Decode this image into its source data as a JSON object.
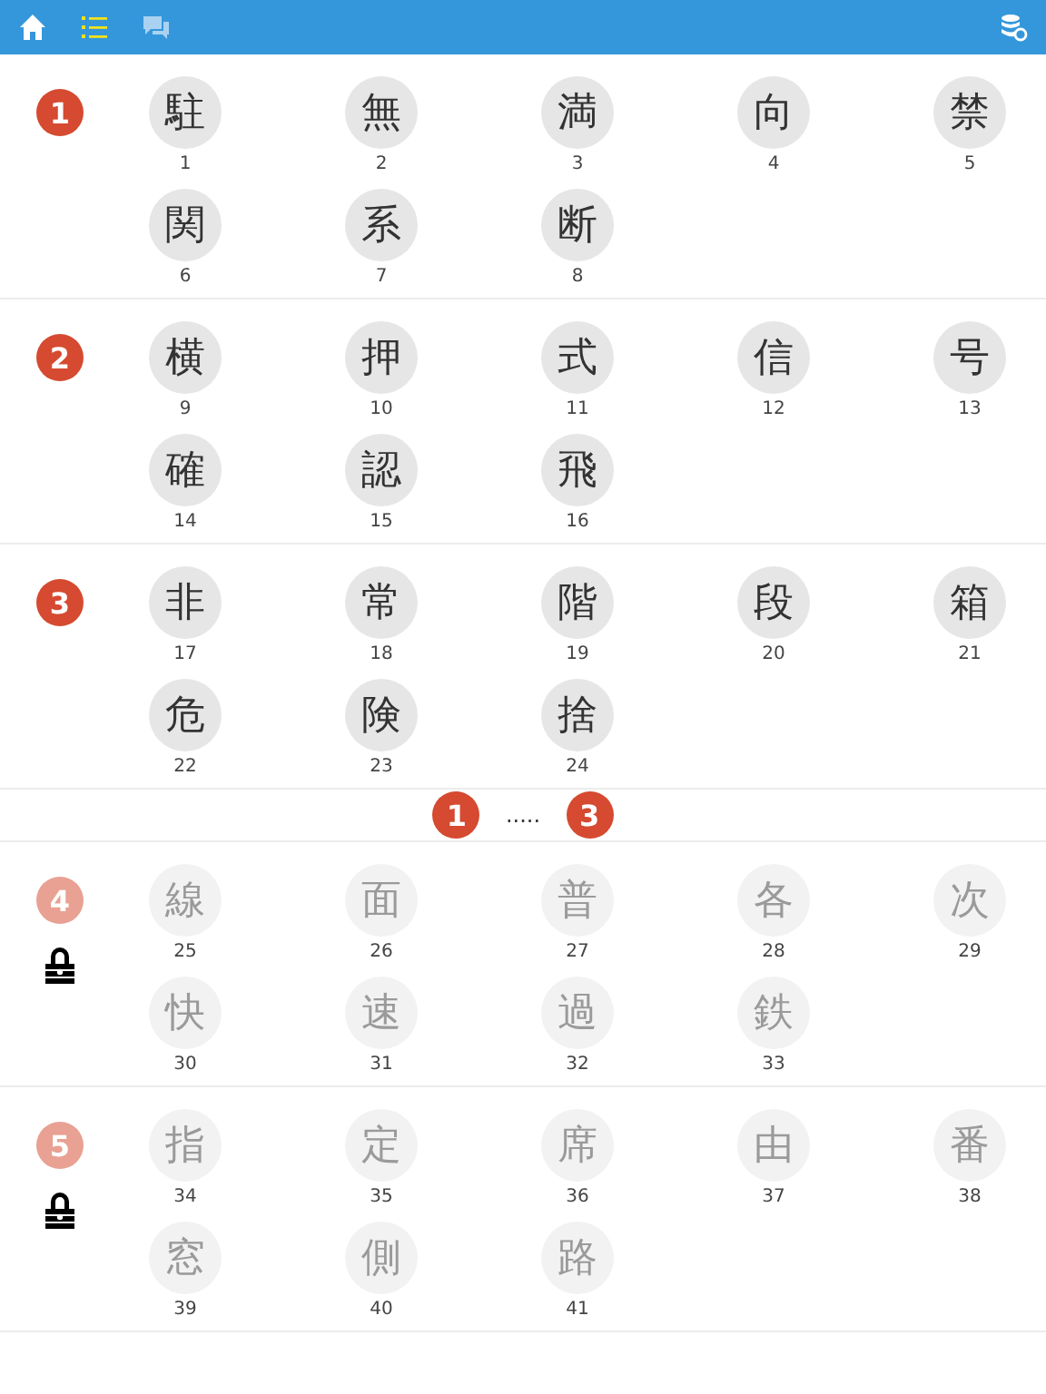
{
  "nav": [
    {
      "kind": "home",
      "selected": false,
      "disabled": false
    },
    {
      "kind": "list",
      "selected": true,
      "disabled": false
    },
    {
      "kind": "chat",
      "selected": false,
      "disabled": true
    }
  ],
  "nav_right": {
    "kind": "database-refresh"
  },
  "sections": [
    {
      "kind": "lesson",
      "number": "1",
      "locked": false,
      "kanji": [
        {
          "char": "駐",
          "number": "1"
        },
        {
          "char": "無",
          "number": "2"
        },
        {
          "char": "満",
          "number": "3"
        },
        {
          "char": "向",
          "number": "4"
        },
        {
          "char": "禁",
          "number": "5"
        },
        {
          "char": "関",
          "number": "6"
        },
        {
          "char": "系",
          "number": "7"
        },
        {
          "char": "断",
          "number": "8"
        }
      ]
    },
    {
      "kind": "lesson",
      "number": "2",
      "locked": false,
      "kanji": [
        {
          "char": "横",
          "number": "9"
        },
        {
          "char": "押",
          "number": "10"
        },
        {
          "char": "式",
          "number": "11"
        },
        {
          "char": "信",
          "number": "12"
        },
        {
          "char": "号",
          "number": "13"
        },
        {
          "char": "確",
          "number": "14"
        },
        {
          "char": "認",
          "number": "15"
        },
        {
          "char": "飛",
          "number": "16"
        }
      ]
    },
    {
      "kind": "lesson",
      "number": "3",
      "locked": false,
      "kanji": [
        {
          "char": "非",
          "number": "17"
        },
        {
          "char": "常",
          "number": "18"
        },
        {
          "char": "階",
          "number": "19"
        },
        {
          "char": "段",
          "number": "20"
        },
        {
          "char": "箱",
          "number": "21"
        },
        {
          "char": "危",
          "number": "22"
        },
        {
          "char": "険",
          "number": "23"
        },
        {
          "char": "捨",
          "number": "24"
        }
      ]
    },
    {
      "kind": "range",
      "from": "1",
      "dots": ".....",
      "to": "3"
    },
    {
      "kind": "lesson",
      "number": "4",
      "locked": true,
      "kanji": [
        {
          "char": "線",
          "number": "25"
        },
        {
          "char": "面",
          "number": "26"
        },
        {
          "char": "普",
          "number": "27"
        },
        {
          "char": "各",
          "number": "28"
        },
        {
          "char": "次",
          "number": "29"
        },
        {
          "char": "快",
          "number": "30"
        },
        {
          "char": "速",
          "number": "31"
        },
        {
          "char": "過",
          "number": "32"
        },
        {
          "char": "鉄",
          "number": "33"
        }
      ]
    },
    {
      "kind": "lesson",
      "number": "5",
      "locked": true,
      "kanji": [
        {
          "char": "指",
          "number": "34"
        },
        {
          "char": "定",
          "number": "35"
        },
        {
          "char": "席",
          "number": "36"
        },
        {
          "char": "由",
          "number": "37"
        },
        {
          "char": "番",
          "number": "38"
        },
        {
          "char": "窓",
          "number": "39"
        },
        {
          "char": "側",
          "number": "40"
        },
        {
          "char": "路",
          "number": "41"
        }
      ]
    }
  ]
}
